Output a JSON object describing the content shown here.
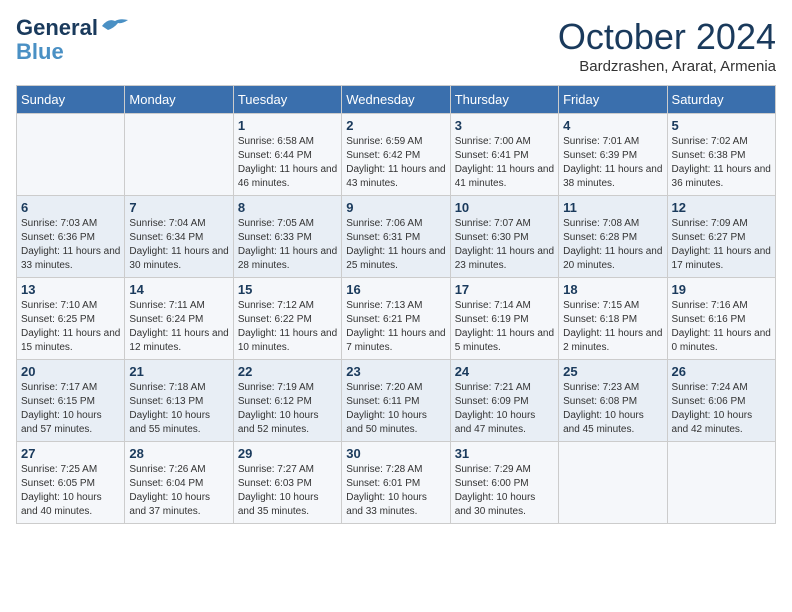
{
  "logo": {
    "line1": "General",
    "line2": "Blue"
  },
  "title": "October 2024",
  "location": "Bardzrashen, Ararat, Armenia",
  "days_of_week": [
    "Sunday",
    "Monday",
    "Tuesday",
    "Wednesday",
    "Thursday",
    "Friday",
    "Saturday"
  ],
  "weeks": [
    [
      {
        "day": "",
        "sunrise": "",
        "sunset": "",
        "daylight": ""
      },
      {
        "day": "",
        "sunrise": "",
        "sunset": "",
        "daylight": ""
      },
      {
        "day": "1",
        "sunrise": "Sunrise: 6:58 AM",
        "sunset": "Sunset: 6:44 PM",
        "daylight": "Daylight: 11 hours and 46 minutes."
      },
      {
        "day": "2",
        "sunrise": "Sunrise: 6:59 AM",
        "sunset": "Sunset: 6:42 PM",
        "daylight": "Daylight: 11 hours and 43 minutes."
      },
      {
        "day": "3",
        "sunrise": "Sunrise: 7:00 AM",
        "sunset": "Sunset: 6:41 PM",
        "daylight": "Daylight: 11 hours and 41 minutes."
      },
      {
        "day": "4",
        "sunrise": "Sunrise: 7:01 AM",
        "sunset": "Sunset: 6:39 PM",
        "daylight": "Daylight: 11 hours and 38 minutes."
      },
      {
        "day": "5",
        "sunrise": "Sunrise: 7:02 AM",
        "sunset": "Sunset: 6:38 PM",
        "daylight": "Daylight: 11 hours and 36 minutes."
      }
    ],
    [
      {
        "day": "6",
        "sunrise": "Sunrise: 7:03 AM",
        "sunset": "Sunset: 6:36 PM",
        "daylight": "Daylight: 11 hours and 33 minutes."
      },
      {
        "day": "7",
        "sunrise": "Sunrise: 7:04 AM",
        "sunset": "Sunset: 6:34 PM",
        "daylight": "Daylight: 11 hours and 30 minutes."
      },
      {
        "day": "8",
        "sunrise": "Sunrise: 7:05 AM",
        "sunset": "Sunset: 6:33 PM",
        "daylight": "Daylight: 11 hours and 28 minutes."
      },
      {
        "day": "9",
        "sunrise": "Sunrise: 7:06 AM",
        "sunset": "Sunset: 6:31 PM",
        "daylight": "Daylight: 11 hours and 25 minutes."
      },
      {
        "day": "10",
        "sunrise": "Sunrise: 7:07 AM",
        "sunset": "Sunset: 6:30 PM",
        "daylight": "Daylight: 11 hours and 23 minutes."
      },
      {
        "day": "11",
        "sunrise": "Sunrise: 7:08 AM",
        "sunset": "Sunset: 6:28 PM",
        "daylight": "Daylight: 11 hours and 20 minutes."
      },
      {
        "day": "12",
        "sunrise": "Sunrise: 7:09 AM",
        "sunset": "Sunset: 6:27 PM",
        "daylight": "Daylight: 11 hours and 17 minutes."
      }
    ],
    [
      {
        "day": "13",
        "sunrise": "Sunrise: 7:10 AM",
        "sunset": "Sunset: 6:25 PM",
        "daylight": "Daylight: 11 hours and 15 minutes."
      },
      {
        "day": "14",
        "sunrise": "Sunrise: 7:11 AM",
        "sunset": "Sunset: 6:24 PM",
        "daylight": "Daylight: 11 hours and 12 minutes."
      },
      {
        "day": "15",
        "sunrise": "Sunrise: 7:12 AM",
        "sunset": "Sunset: 6:22 PM",
        "daylight": "Daylight: 11 hours and 10 minutes."
      },
      {
        "day": "16",
        "sunrise": "Sunrise: 7:13 AM",
        "sunset": "Sunset: 6:21 PM",
        "daylight": "Daylight: 11 hours and 7 minutes."
      },
      {
        "day": "17",
        "sunrise": "Sunrise: 7:14 AM",
        "sunset": "Sunset: 6:19 PM",
        "daylight": "Daylight: 11 hours and 5 minutes."
      },
      {
        "day": "18",
        "sunrise": "Sunrise: 7:15 AM",
        "sunset": "Sunset: 6:18 PM",
        "daylight": "Daylight: 11 hours and 2 minutes."
      },
      {
        "day": "19",
        "sunrise": "Sunrise: 7:16 AM",
        "sunset": "Sunset: 6:16 PM",
        "daylight": "Daylight: 11 hours and 0 minutes."
      }
    ],
    [
      {
        "day": "20",
        "sunrise": "Sunrise: 7:17 AM",
        "sunset": "Sunset: 6:15 PM",
        "daylight": "Daylight: 10 hours and 57 minutes."
      },
      {
        "day": "21",
        "sunrise": "Sunrise: 7:18 AM",
        "sunset": "Sunset: 6:13 PM",
        "daylight": "Daylight: 10 hours and 55 minutes."
      },
      {
        "day": "22",
        "sunrise": "Sunrise: 7:19 AM",
        "sunset": "Sunset: 6:12 PM",
        "daylight": "Daylight: 10 hours and 52 minutes."
      },
      {
        "day": "23",
        "sunrise": "Sunrise: 7:20 AM",
        "sunset": "Sunset: 6:11 PM",
        "daylight": "Daylight: 10 hours and 50 minutes."
      },
      {
        "day": "24",
        "sunrise": "Sunrise: 7:21 AM",
        "sunset": "Sunset: 6:09 PM",
        "daylight": "Daylight: 10 hours and 47 minutes."
      },
      {
        "day": "25",
        "sunrise": "Sunrise: 7:23 AM",
        "sunset": "Sunset: 6:08 PM",
        "daylight": "Daylight: 10 hours and 45 minutes."
      },
      {
        "day": "26",
        "sunrise": "Sunrise: 7:24 AM",
        "sunset": "Sunset: 6:06 PM",
        "daylight": "Daylight: 10 hours and 42 minutes."
      }
    ],
    [
      {
        "day": "27",
        "sunrise": "Sunrise: 7:25 AM",
        "sunset": "Sunset: 6:05 PM",
        "daylight": "Daylight: 10 hours and 40 minutes."
      },
      {
        "day": "28",
        "sunrise": "Sunrise: 7:26 AM",
        "sunset": "Sunset: 6:04 PM",
        "daylight": "Daylight: 10 hours and 37 minutes."
      },
      {
        "day": "29",
        "sunrise": "Sunrise: 7:27 AM",
        "sunset": "Sunset: 6:03 PM",
        "daylight": "Daylight: 10 hours and 35 minutes."
      },
      {
        "day": "30",
        "sunrise": "Sunrise: 7:28 AM",
        "sunset": "Sunset: 6:01 PM",
        "daylight": "Daylight: 10 hours and 33 minutes."
      },
      {
        "day": "31",
        "sunrise": "Sunrise: 7:29 AM",
        "sunset": "Sunset: 6:00 PM",
        "daylight": "Daylight: 10 hours and 30 minutes."
      },
      {
        "day": "",
        "sunrise": "",
        "sunset": "",
        "daylight": ""
      },
      {
        "day": "",
        "sunrise": "",
        "sunset": "",
        "daylight": ""
      }
    ]
  ]
}
